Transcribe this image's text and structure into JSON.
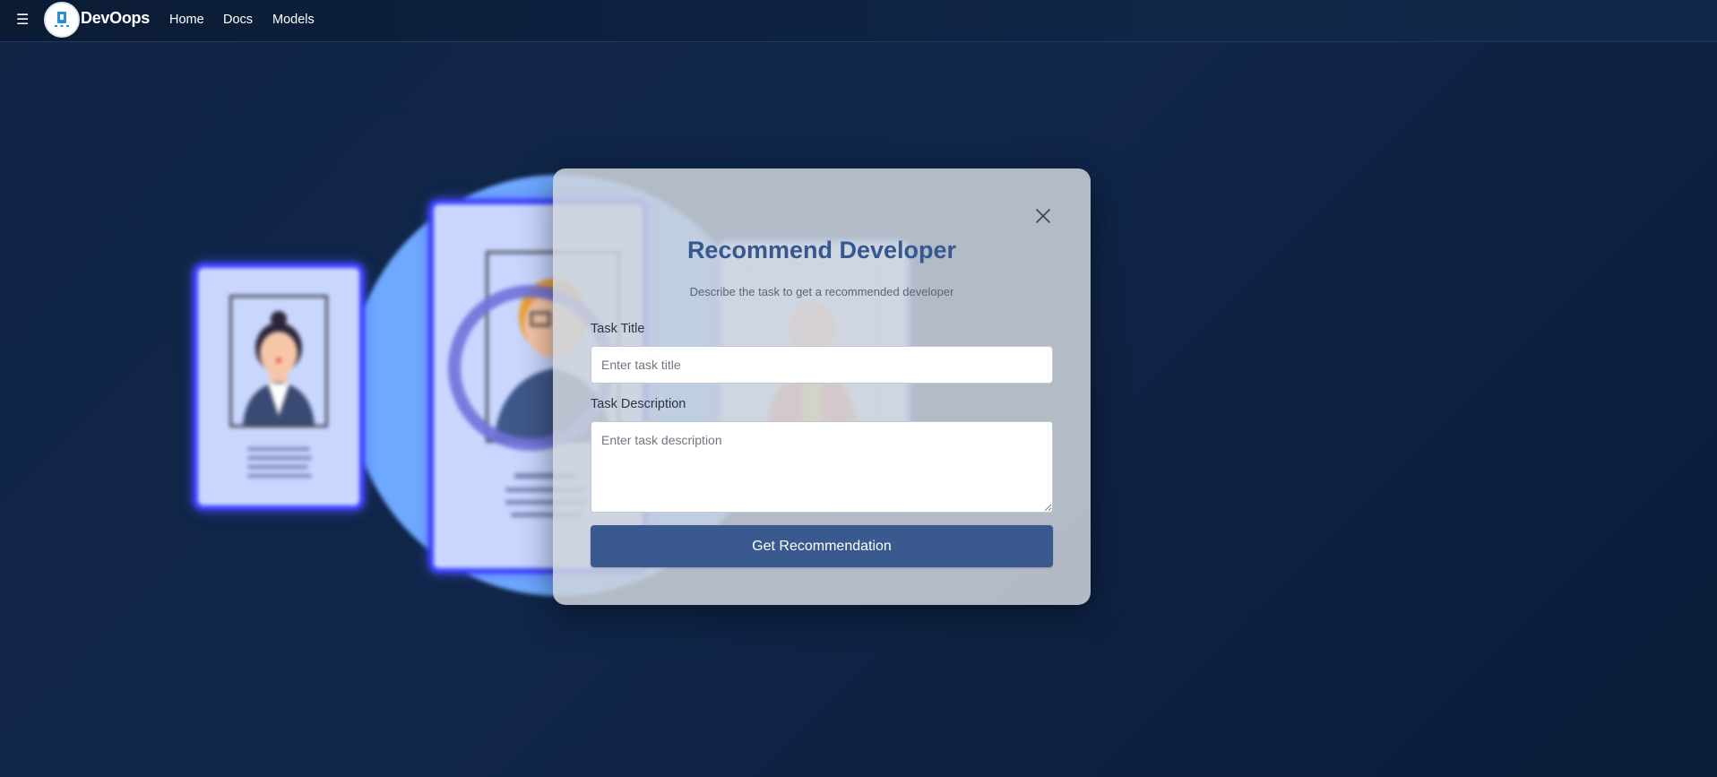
{
  "nav": {
    "brand": "DevOops",
    "links": [
      "Home",
      "Docs",
      "Models"
    ]
  },
  "modal": {
    "title": "Recommend Developer",
    "subtitle": "Describe the task to get a recommended developer",
    "task_title_label": "Task Title",
    "task_title_placeholder": "Enter task title",
    "task_title_value": "",
    "task_description_label": "Task Description",
    "task_description_placeholder": "Enter task description",
    "task_description_value": "",
    "submit_label": "Get Recommendation"
  },
  "colors": {
    "background": "#0f2445",
    "accent": "#3a5a8f",
    "title": "#34588f"
  },
  "icons": {
    "menu": "hamburger-icon",
    "close": "close-icon",
    "logo": "devoops-logo"
  }
}
